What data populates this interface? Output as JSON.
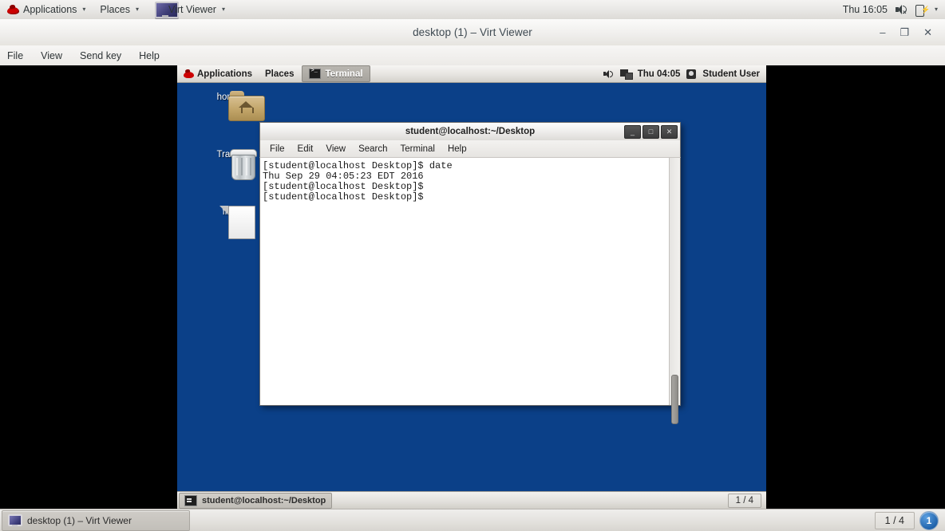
{
  "host_panel": {
    "logo_icon": "redhat-logo-icon",
    "applications_label": "Applications",
    "places_label": "Places",
    "active_app_label": "Virt Viewer",
    "active_app_icon": "monitor-icon",
    "clock": "Thu 16:05",
    "volume_icon": "speaker-muted-icon",
    "battery_icon": "battery-charging-icon",
    "caret": "▾"
  },
  "virt_viewer": {
    "title": "desktop (1) – Virt Viewer",
    "minimize_label": "–",
    "maximize_label": "❐",
    "close_label": "✕",
    "menus": [
      "File",
      "View",
      "Send key",
      "Help"
    ]
  },
  "guest": {
    "panel": {
      "logo_icon": "redhat-logo-icon",
      "applications_label": "Applications",
      "places_label": "Places",
      "active_window_label": "Terminal",
      "active_window_icon": "terminal-icon",
      "volume_icon": "volume-icon",
      "network_icon": "network-icon",
      "clock": "Thu 04:05",
      "user_icon": "user-icon",
      "user_label": "Student User"
    },
    "desktop_icons": [
      {
        "name": "home",
        "label": "home",
        "icon": "home-folder-icon"
      },
      {
        "name": "trash",
        "label": "Trash",
        "icon": "trash-icon"
      },
      {
        "name": "file",
        "label": "file",
        "icon": "file-icon"
      }
    ],
    "terminal": {
      "title": "student@localhost:~/Desktop",
      "minimize_label": "_",
      "maximize_label": "□",
      "close_label": "✕",
      "menus": [
        "File",
        "Edit",
        "View",
        "Search",
        "Terminal",
        "Help"
      ],
      "content": "[student@localhost Desktop]$ date\nThu Sep 29 04:05:23 EDT 2016\n[student@localhost Desktop]$\n[student@localhost Desktop]$"
    },
    "bottom_panel": {
      "task_label": "student@localhost:~/Desktop",
      "task_icon": "terminal-icon",
      "workspace_label": "1 / 4"
    }
  },
  "host_taskbar": {
    "task_label": "desktop (1) – Virt Viewer",
    "task_icon": "monitor-icon",
    "workspace_label": "1 / 4",
    "workspace_badge": "1"
  },
  "colors": {
    "desktop_blue": "#0b4088",
    "panel_grey": "#e6e4e0",
    "accent_blue": "#1c5fa8",
    "redhat_red": "#cc0000"
  }
}
